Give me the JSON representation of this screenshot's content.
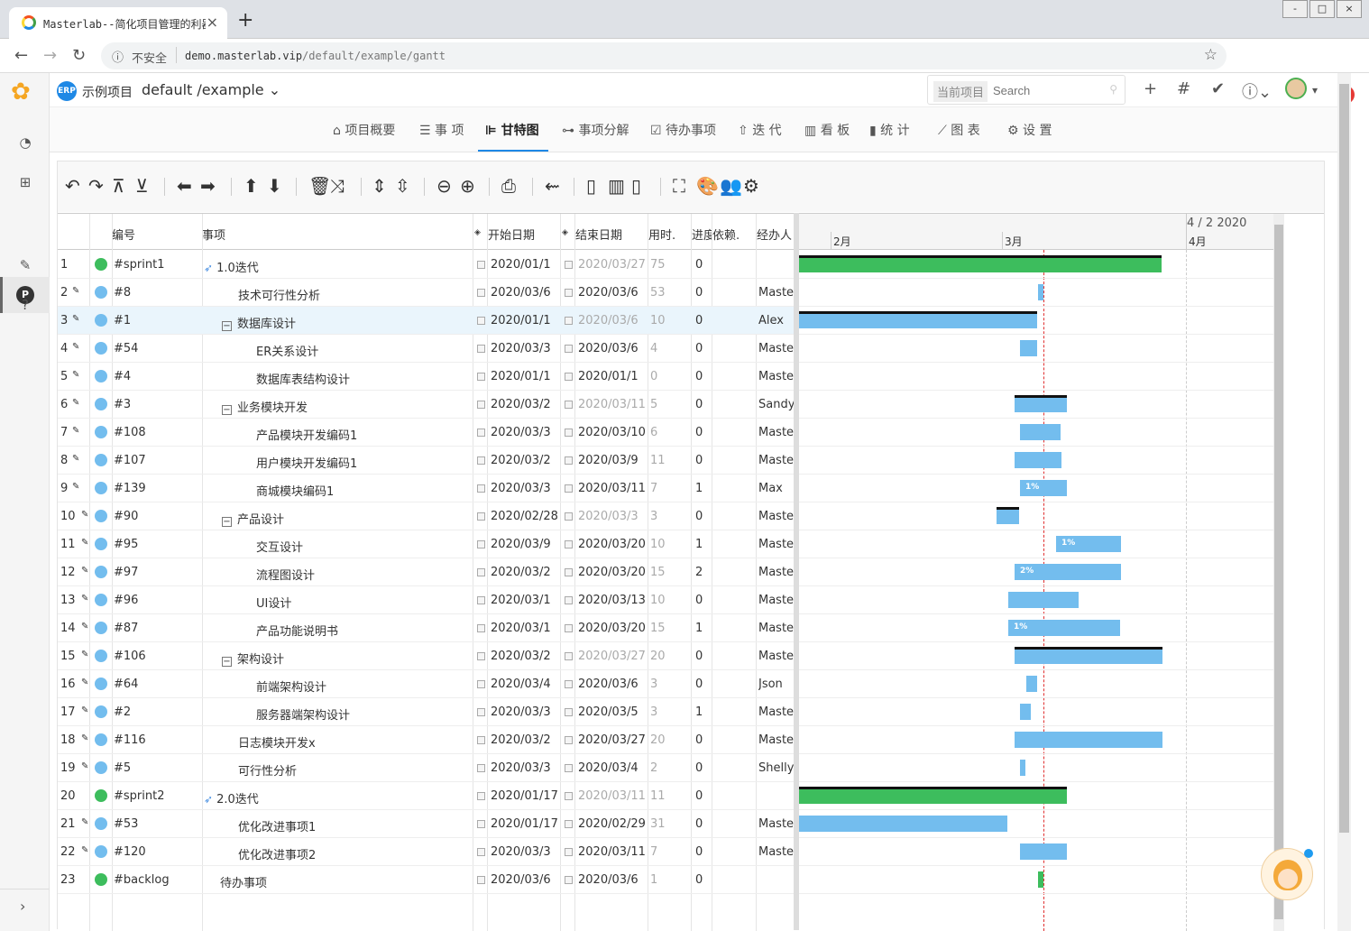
{
  "browser": {
    "tab_title": "Masterlab--简化项目管理的利器",
    "insecure_label": "不安全",
    "url_host": "demo.masterlab.vip",
    "url_path": "/default/example/gantt",
    "window_controls": [
      "-",
      "□",
      "×"
    ]
  },
  "header": {
    "project_badge": "ERP",
    "project_name": "示例项目",
    "project_path": "default /example",
    "search_label": "当前项目",
    "search_placeholder": "Search"
  },
  "subnav": {
    "items": [
      "项目概要",
      "事 项",
      "甘特图",
      "事项分解",
      "待办事项",
      "迭 代",
      "看 板",
      "统 计",
      "图 表",
      "设 置"
    ],
    "active": "甘特图"
  },
  "columns": {
    "id": "编号",
    "name": "事项",
    "start": "开始日期",
    "end": "结束日期",
    "duration": "用时.",
    "progress": "进度",
    "depends": "依赖.",
    "assignee": "经办人"
  },
  "gantt_header": {
    "date_label": "4 / 2 2020",
    "months": [
      "2月",
      "3月",
      "4月"
    ]
  },
  "rows": [
    {
      "n": "1",
      "id": "#sprint1",
      "name": "1.0迭代",
      "start": "2020/01/1",
      "end": "2020/03/27",
      "dur": "75",
      "prog": "0",
      "assignee": "",
      "dot": "#3dbd5d",
      "end_gray": true,
      "pen": false
    },
    {
      "n": "2",
      "id": "#8",
      "name": "技术可行性分析",
      "start": "2020/03/6",
      "end": "2020/03/6",
      "dur": "53",
      "prog": "0",
      "assignee": "Master",
      "dot": "#73bdee",
      "end_gray": false,
      "pen": true
    },
    {
      "n": "3",
      "id": "#1",
      "name": "数据库设计",
      "start": "2020/01/1",
      "end": "2020/03/6",
      "dur": "10",
      "prog": "0",
      "assignee": "Alex",
      "dot": "#73bdee",
      "end_gray": true,
      "pen": true
    },
    {
      "n": "4",
      "id": "#54",
      "name": "ER关系设计",
      "start": "2020/03/3",
      "end": "2020/03/6",
      "dur": "4",
      "prog": "0",
      "assignee": "Master",
      "dot": "#73bdee",
      "end_gray": false,
      "pen": true
    },
    {
      "n": "5",
      "id": "#4",
      "name": "数据库表结构设计",
      "start": "2020/01/1",
      "end": "2020/01/1",
      "dur": "0",
      "prog": "0",
      "assignee": "Master",
      "dot": "#73bdee",
      "end_gray": false,
      "pen": true
    },
    {
      "n": "6",
      "id": "#3",
      "name": "业务模块开发",
      "start": "2020/03/2",
      "end": "2020/03/11",
      "dur": "5",
      "prog": "0",
      "assignee": "Sandy",
      "dot": "#73bdee",
      "end_gray": true,
      "pen": true
    },
    {
      "n": "7",
      "id": "#108",
      "name": "产品模块开发编码1",
      "start": "2020/03/3",
      "end": "2020/03/10",
      "dur": "6",
      "prog": "0",
      "assignee": "Master",
      "dot": "#73bdee",
      "end_gray": false,
      "pen": true
    },
    {
      "n": "8",
      "id": "#107",
      "name": "用户模块开发编码1",
      "start": "2020/03/2",
      "end": "2020/03/9",
      "dur": "11",
      "prog": "0",
      "assignee": "Master",
      "dot": "#73bdee",
      "end_gray": false,
      "pen": true
    },
    {
      "n": "9",
      "id": "#139",
      "name": "商城模块编码1",
      "start": "2020/03/3",
      "end": "2020/03/11",
      "dur": "7",
      "prog": "1",
      "assignee": "Max",
      "dot": "#73bdee",
      "end_gray": false,
      "pen": true
    },
    {
      "n": "10",
      "id": "#90",
      "name": "产品设计",
      "start": "2020/02/28",
      "end": "2020/03/3",
      "dur": "3",
      "prog": "0",
      "assignee": "Master",
      "dot": "#73bdee",
      "end_gray": true,
      "pen": true
    },
    {
      "n": "11",
      "id": "#95",
      "name": "交互设计",
      "start": "2020/03/9",
      "end": "2020/03/20",
      "dur": "10",
      "prog": "1",
      "assignee": "Master",
      "dot": "#73bdee",
      "end_gray": false,
      "pen": true
    },
    {
      "n": "12",
      "id": "#97",
      "name": "流程图设计",
      "start": "2020/03/2",
      "end": "2020/03/20",
      "dur": "15",
      "prog": "2",
      "assignee": "Master",
      "dot": "#73bdee",
      "end_gray": false,
      "pen": true
    },
    {
      "n": "13",
      "id": "#96",
      "name": "UI设计",
      "start": "2020/03/1",
      "end": "2020/03/13",
      "dur": "10",
      "prog": "0",
      "assignee": "Master",
      "dot": "#73bdee",
      "end_gray": false,
      "pen": true
    },
    {
      "n": "14",
      "id": "#87",
      "name": "产品功能说明书",
      "start": "2020/03/1",
      "end": "2020/03/20",
      "dur": "15",
      "prog": "1",
      "assignee": "Master",
      "dot": "#73bdee",
      "end_gray": false,
      "pen": true
    },
    {
      "n": "15",
      "id": "#106",
      "name": "架构设计",
      "start": "2020/03/2",
      "end": "2020/03/27",
      "dur": "20",
      "prog": "0",
      "assignee": "Master",
      "dot": "#73bdee",
      "end_gray": true,
      "pen": true
    },
    {
      "n": "16",
      "id": "#64",
      "name": "前端架构设计",
      "start": "2020/03/4",
      "end": "2020/03/6",
      "dur": "3",
      "prog": "0",
      "assignee": "Json",
      "dot": "#73bdee",
      "end_gray": false,
      "pen": true
    },
    {
      "n": "17",
      "id": "#2",
      "name": "服务器端架构设计",
      "start": "2020/03/3",
      "end": "2020/03/5",
      "dur": "3",
      "prog": "1",
      "assignee": "Master",
      "dot": "#73bdee",
      "end_gray": false,
      "pen": true
    },
    {
      "n": "18",
      "id": "#116",
      "name": "日志模块开发x",
      "start": "2020/03/2",
      "end": "2020/03/27",
      "dur": "20",
      "prog": "0",
      "assignee": "Master",
      "dot": "#73bdee",
      "end_gray": false,
      "pen": true
    },
    {
      "n": "19",
      "id": "#5",
      "name": "可行性分析",
      "start": "2020/03/3",
      "end": "2020/03/4",
      "dur": "2",
      "prog": "0",
      "assignee": "Shelly",
      "dot": "#73bdee",
      "end_gray": false,
      "pen": true
    },
    {
      "n": "20",
      "id": "#sprint2",
      "name": "2.0迭代",
      "start": "2020/01/17",
      "end": "2020/03/11",
      "dur": "11",
      "prog": "0",
      "assignee": "",
      "dot": "#3dbd5d",
      "end_gray": true,
      "pen": false
    },
    {
      "n": "21",
      "id": "#53",
      "name": "优化改进事项1",
      "start": "2020/01/17",
      "end": "2020/02/29",
      "dur": "31",
      "prog": "0",
      "assignee": "Master",
      "dot": "#73bdee",
      "end_gray": false,
      "pen": true
    },
    {
      "n": "22",
      "id": "#120",
      "name": "优化改进事项2",
      "start": "2020/03/3",
      "end": "2020/03/11",
      "dur": "7",
      "prog": "0",
      "assignee": "Master",
      "dot": "#73bdee",
      "end_gray": false,
      "pen": true
    },
    {
      "n": "23",
      "id": "#backlog",
      "name": "待办事项",
      "start": "2020/03/6",
      "end": "2020/03/6",
      "dur": "1",
      "prog": "0",
      "assignee": "",
      "dot": "#3dbd5d",
      "end_gray": false,
      "pen": false
    }
  ],
  "bars": [
    {
      "kind": "sprint",
      "pct": ""
    },
    {
      "kind": "task",
      "pct": ""
    },
    {
      "kind": "group",
      "pct": ""
    },
    {
      "kind": "task",
      "pct": ""
    },
    {
      "kind": "none",
      "pct": ""
    },
    {
      "kind": "group",
      "pct": ""
    },
    {
      "kind": "task",
      "pct": ""
    },
    {
      "kind": "task",
      "pct": ""
    },
    {
      "kind": "task",
      "pct": "1%"
    },
    {
      "kind": "group",
      "pct": ""
    },
    {
      "kind": "task",
      "pct": "1%"
    },
    {
      "kind": "task",
      "pct": "2%"
    },
    {
      "kind": "task",
      "pct": ""
    },
    {
      "kind": "task",
      "pct": "1%"
    },
    {
      "kind": "group",
      "pct": ""
    },
    {
      "kind": "task",
      "pct": ""
    },
    {
      "kind": "task",
      "pct": ""
    },
    {
      "kind": "task",
      "pct": ""
    },
    {
      "kind": "task",
      "pct": ""
    },
    {
      "kind": "sprint",
      "pct": ""
    },
    {
      "kind": "task",
      "pct": ""
    },
    {
      "kind": "task",
      "pct": ""
    },
    {
      "kind": "backlog",
      "pct": ""
    }
  ]
}
